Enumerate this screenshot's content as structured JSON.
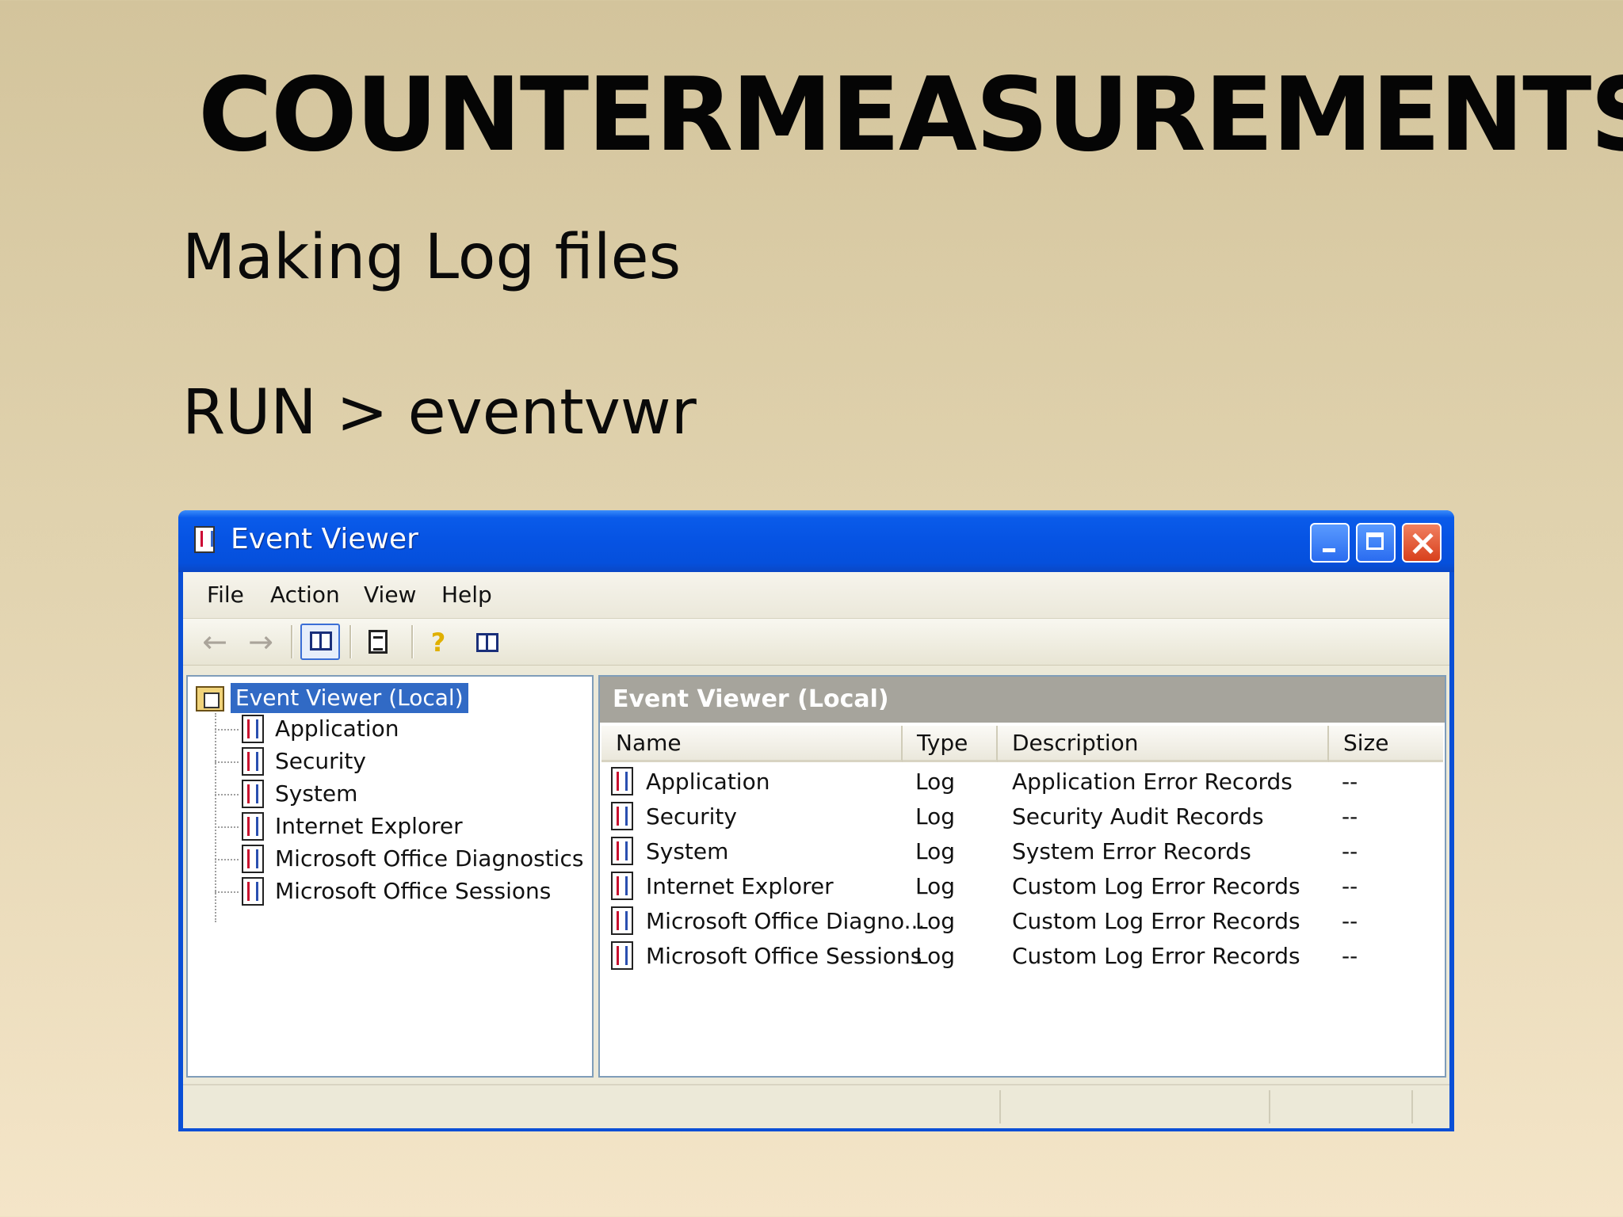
{
  "slide": {
    "title": "COUNTERMEASUREMENTS",
    "bullet1": "Making Log files",
    "bullet2": "RUN > eventvwr"
  },
  "window": {
    "title": "Event Viewer",
    "menu": [
      "File",
      "Action",
      "View",
      "Help"
    ],
    "toolbar_icons": [
      "back-arrow-icon",
      "forward-arrow-icon",
      "show-hide-tree-icon",
      "export-list-icon",
      "help-icon",
      "show-hide-action-pane-icon"
    ]
  },
  "tree": {
    "root": "Event Viewer (Local)",
    "items": [
      "Application",
      "Security",
      "System",
      "Internet Explorer",
      "Microsoft Office Diagnostics",
      "Microsoft Office Sessions"
    ]
  },
  "list": {
    "header": "Event Viewer (Local)",
    "columns": [
      "Name",
      "Type",
      "Description",
      "Size"
    ],
    "rows": [
      {
        "name": "Application",
        "type": "Log",
        "description": "Application Error Records",
        "size": "--"
      },
      {
        "name": "Security",
        "type": "Log",
        "description": "Security Audit Records",
        "size": "--"
      },
      {
        "name": "System",
        "type": "Log",
        "description": "System Error Records",
        "size": "--"
      },
      {
        "name": "Internet Explorer",
        "type": "Log",
        "description": "Custom Log Error Records",
        "size": "--"
      },
      {
        "name": "Microsoft Office Diagno...",
        "type": "Log",
        "description": "Custom Log Error Records",
        "size": "--"
      },
      {
        "name": "Microsoft Office Sessions",
        "type": "Log",
        "description": "Custom Log Error Records",
        "size": "--"
      }
    ]
  },
  "colors": {
    "titlebar": "#0653e3",
    "selection": "#316ac5",
    "pane_header": "#a6a49c"
  }
}
